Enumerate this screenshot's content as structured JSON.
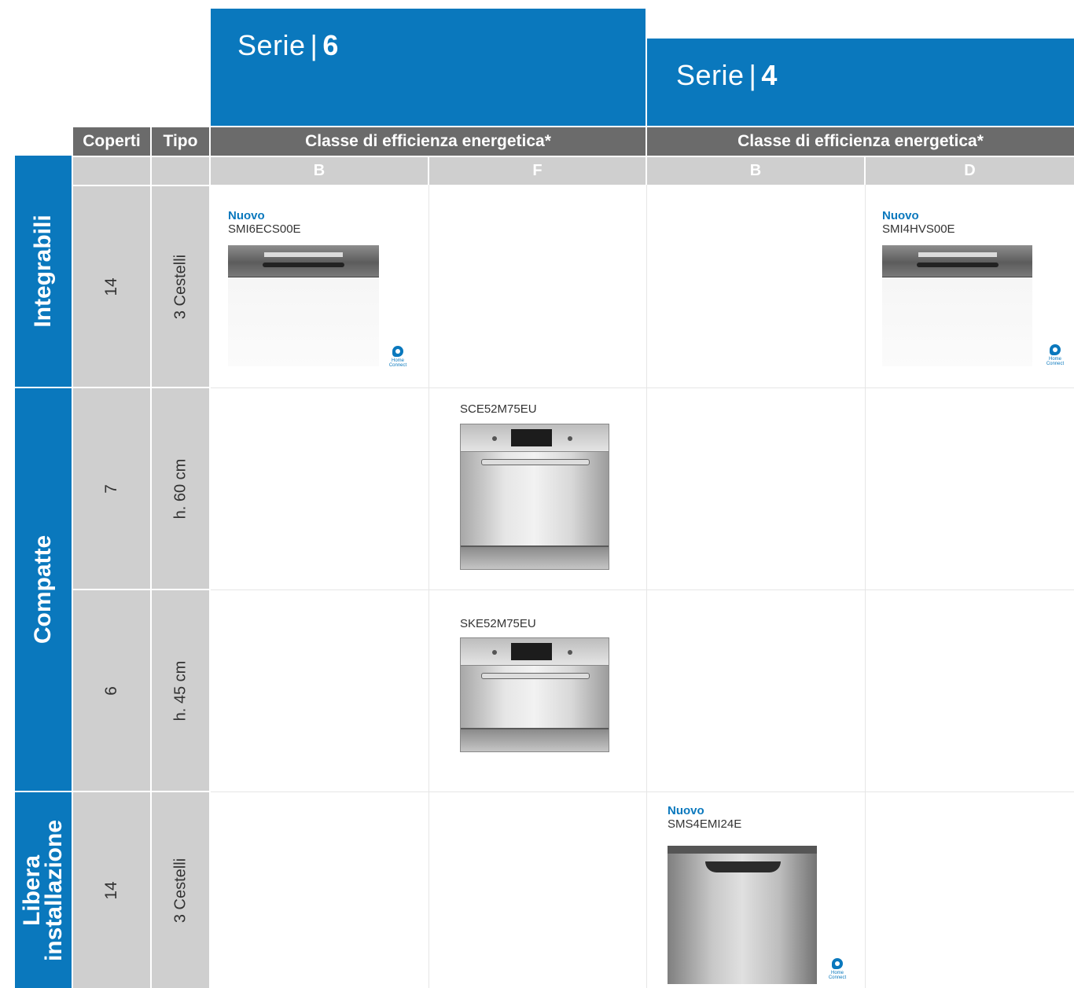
{
  "series": [
    {
      "prefix": "Serie",
      "separator": "|",
      "number": "6"
    },
    {
      "prefix": "Serie",
      "separator": "|",
      "number": "4"
    }
  ],
  "headers": {
    "coperti": "Coperti",
    "tipo": "Tipo",
    "energy_class": "Classe di efficienza energetica*",
    "classes": [
      "B",
      "F",
      "B",
      "D"
    ]
  },
  "categories": [
    {
      "label": "Integrabili"
    },
    {
      "label": "Compatte"
    },
    {
      "label_line1": "Libera",
      "label_line2": "installazione"
    }
  ],
  "rows": [
    {
      "coperti": "14",
      "tipo": "3 Cestelli"
    },
    {
      "coperti": "7",
      "tipo": "h. 60 cm"
    },
    {
      "coperti": "6",
      "tipo": "h. 45 cm"
    },
    {
      "coperti": "14",
      "tipo": "3 Cestelli"
    }
  ],
  "products": {
    "smi6": {
      "badge": "Nuovo",
      "model": "SMI6ECS00E",
      "icon": "home-connect-icon",
      "hc_text": "Home Connect"
    },
    "smi4": {
      "badge": "Nuovo",
      "model": "SMI4HVS00E",
      "icon": "home-connect-icon",
      "hc_text": "Home Connect"
    },
    "sce": {
      "model": "SCE52M75EU"
    },
    "ske": {
      "model": "SKE52M75EU"
    },
    "sms4": {
      "badge": "Nuovo",
      "model": "SMS4EMI24E",
      "icon": "home-connect-icon",
      "hc_text": "Home Connect"
    }
  },
  "colors": {
    "brand_blue": "#0a78bd",
    "header_dark": "#6b6b6b",
    "header_light": "#cfcfcf"
  }
}
